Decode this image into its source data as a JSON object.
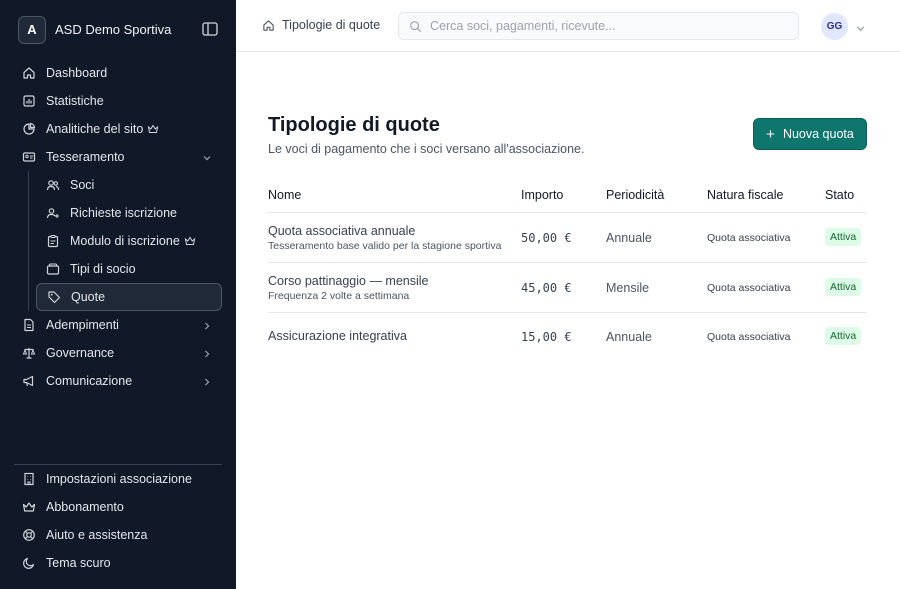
{
  "org": {
    "initial": "A",
    "name": "ASD Demo Sportiva"
  },
  "sidebar": {
    "items": [
      {
        "label": "Dashboard"
      },
      {
        "label": "Statistiche"
      },
      {
        "label": "Analitiche del sito"
      },
      {
        "label": "Tesseramento"
      }
    ],
    "tesseramento_items": [
      {
        "label": "Soci"
      },
      {
        "label": "Richieste iscrizione"
      },
      {
        "label": "Modulo di iscrizione"
      },
      {
        "label": "Tipi di socio"
      },
      {
        "label": "Quote"
      }
    ],
    "more_items": [
      {
        "label": "Adempimenti"
      },
      {
        "label": "Governance"
      },
      {
        "label": "Comunicazione"
      }
    ],
    "footer_items": [
      {
        "label": "Impostazioni associazione"
      },
      {
        "label": "Abbonamento"
      },
      {
        "label": "Aiuto e assistenza"
      },
      {
        "label": "Tema scuro"
      }
    ]
  },
  "topbar": {
    "breadcrumb": "Tipologie di quote",
    "search_placeholder": "Cerca soci, pagamenti, ricevute...",
    "user_initials": "GG"
  },
  "page": {
    "title": "Tipologie di quote",
    "subtitle": "Le voci di pagamento che i soci versano all'associazione.",
    "new_button": "Nuova quota"
  },
  "table": {
    "headers": {
      "nome": "Nome",
      "importo": "Importo",
      "periodicita": "Periodicità",
      "natura": "Natura fiscale",
      "stato": "Stato"
    },
    "rows": [
      {
        "name": "Quota associativa annuale",
        "desc": "Tesseramento base valido per la stagione sportiva",
        "amount": "50,00 €",
        "period": "Annuale",
        "nature": "Quota associativa",
        "status": "Attiva"
      },
      {
        "name": "Corso pattinaggio — mensile",
        "desc": "Frequenza 2 volte a settimana",
        "amount": "45,00 €",
        "period": "Mensile",
        "nature": "Quota associativa",
        "status": "Attiva"
      },
      {
        "name": "Assicurazione integrativa",
        "desc": "",
        "amount": "15,00 €",
        "period": "Annuale",
        "nature": "Quota associativa",
        "status": "Attiva"
      }
    ]
  },
  "colors": {
    "sidebar_bg": "#111827",
    "accent": "#0f766e",
    "badge_bg": "#dcfce7",
    "badge_text": "#166534"
  }
}
